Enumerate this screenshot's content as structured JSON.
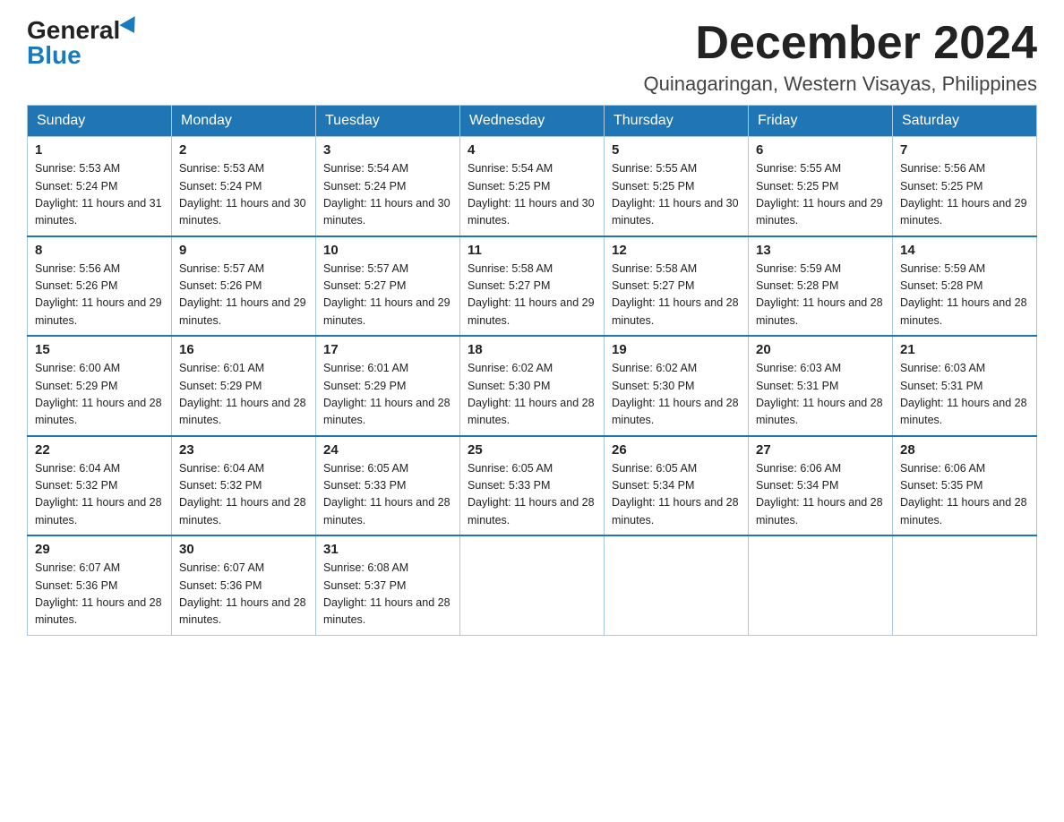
{
  "logo": {
    "general": "General",
    "blue": "Blue"
  },
  "title": "December 2024",
  "location": "Quinagaringan, Western Visayas, Philippines",
  "weekdays": [
    "Sunday",
    "Monday",
    "Tuesday",
    "Wednesday",
    "Thursday",
    "Friday",
    "Saturday"
  ],
  "weeks": [
    [
      {
        "day": "1",
        "sunrise": "5:53 AM",
        "sunset": "5:24 PM",
        "daylight": "11 hours and 31 minutes."
      },
      {
        "day": "2",
        "sunrise": "5:53 AM",
        "sunset": "5:24 PM",
        "daylight": "11 hours and 30 minutes."
      },
      {
        "day": "3",
        "sunrise": "5:54 AM",
        "sunset": "5:24 PM",
        "daylight": "11 hours and 30 minutes."
      },
      {
        "day": "4",
        "sunrise": "5:54 AM",
        "sunset": "5:25 PM",
        "daylight": "11 hours and 30 minutes."
      },
      {
        "day": "5",
        "sunrise": "5:55 AM",
        "sunset": "5:25 PM",
        "daylight": "11 hours and 30 minutes."
      },
      {
        "day": "6",
        "sunrise": "5:55 AM",
        "sunset": "5:25 PM",
        "daylight": "11 hours and 29 minutes."
      },
      {
        "day": "7",
        "sunrise": "5:56 AM",
        "sunset": "5:25 PM",
        "daylight": "11 hours and 29 minutes."
      }
    ],
    [
      {
        "day": "8",
        "sunrise": "5:56 AM",
        "sunset": "5:26 PM",
        "daylight": "11 hours and 29 minutes."
      },
      {
        "day": "9",
        "sunrise": "5:57 AM",
        "sunset": "5:26 PM",
        "daylight": "11 hours and 29 minutes."
      },
      {
        "day": "10",
        "sunrise": "5:57 AM",
        "sunset": "5:27 PM",
        "daylight": "11 hours and 29 minutes."
      },
      {
        "day": "11",
        "sunrise": "5:58 AM",
        "sunset": "5:27 PM",
        "daylight": "11 hours and 29 minutes."
      },
      {
        "day": "12",
        "sunrise": "5:58 AM",
        "sunset": "5:27 PM",
        "daylight": "11 hours and 28 minutes."
      },
      {
        "day": "13",
        "sunrise": "5:59 AM",
        "sunset": "5:28 PM",
        "daylight": "11 hours and 28 minutes."
      },
      {
        "day": "14",
        "sunrise": "5:59 AM",
        "sunset": "5:28 PM",
        "daylight": "11 hours and 28 minutes."
      }
    ],
    [
      {
        "day": "15",
        "sunrise": "6:00 AM",
        "sunset": "5:29 PM",
        "daylight": "11 hours and 28 minutes."
      },
      {
        "day": "16",
        "sunrise": "6:01 AM",
        "sunset": "5:29 PM",
        "daylight": "11 hours and 28 minutes."
      },
      {
        "day": "17",
        "sunrise": "6:01 AM",
        "sunset": "5:29 PM",
        "daylight": "11 hours and 28 minutes."
      },
      {
        "day": "18",
        "sunrise": "6:02 AM",
        "sunset": "5:30 PM",
        "daylight": "11 hours and 28 minutes."
      },
      {
        "day": "19",
        "sunrise": "6:02 AM",
        "sunset": "5:30 PM",
        "daylight": "11 hours and 28 minutes."
      },
      {
        "day": "20",
        "sunrise": "6:03 AM",
        "sunset": "5:31 PM",
        "daylight": "11 hours and 28 minutes."
      },
      {
        "day": "21",
        "sunrise": "6:03 AM",
        "sunset": "5:31 PM",
        "daylight": "11 hours and 28 minutes."
      }
    ],
    [
      {
        "day": "22",
        "sunrise": "6:04 AM",
        "sunset": "5:32 PM",
        "daylight": "11 hours and 28 minutes."
      },
      {
        "day": "23",
        "sunrise": "6:04 AM",
        "sunset": "5:32 PM",
        "daylight": "11 hours and 28 minutes."
      },
      {
        "day": "24",
        "sunrise": "6:05 AM",
        "sunset": "5:33 PM",
        "daylight": "11 hours and 28 minutes."
      },
      {
        "day": "25",
        "sunrise": "6:05 AM",
        "sunset": "5:33 PM",
        "daylight": "11 hours and 28 minutes."
      },
      {
        "day": "26",
        "sunrise": "6:05 AM",
        "sunset": "5:34 PM",
        "daylight": "11 hours and 28 minutes."
      },
      {
        "day": "27",
        "sunrise": "6:06 AM",
        "sunset": "5:34 PM",
        "daylight": "11 hours and 28 minutes."
      },
      {
        "day": "28",
        "sunrise": "6:06 AM",
        "sunset": "5:35 PM",
        "daylight": "11 hours and 28 minutes."
      }
    ],
    [
      {
        "day": "29",
        "sunrise": "6:07 AM",
        "sunset": "5:36 PM",
        "daylight": "11 hours and 28 minutes."
      },
      {
        "day": "30",
        "sunrise": "6:07 AM",
        "sunset": "5:36 PM",
        "daylight": "11 hours and 28 minutes."
      },
      {
        "day": "31",
        "sunrise": "6:08 AM",
        "sunset": "5:37 PM",
        "daylight": "11 hours and 28 minutes."
      },
      null,
      null,
      null,
      null
    ]
  ]
}
